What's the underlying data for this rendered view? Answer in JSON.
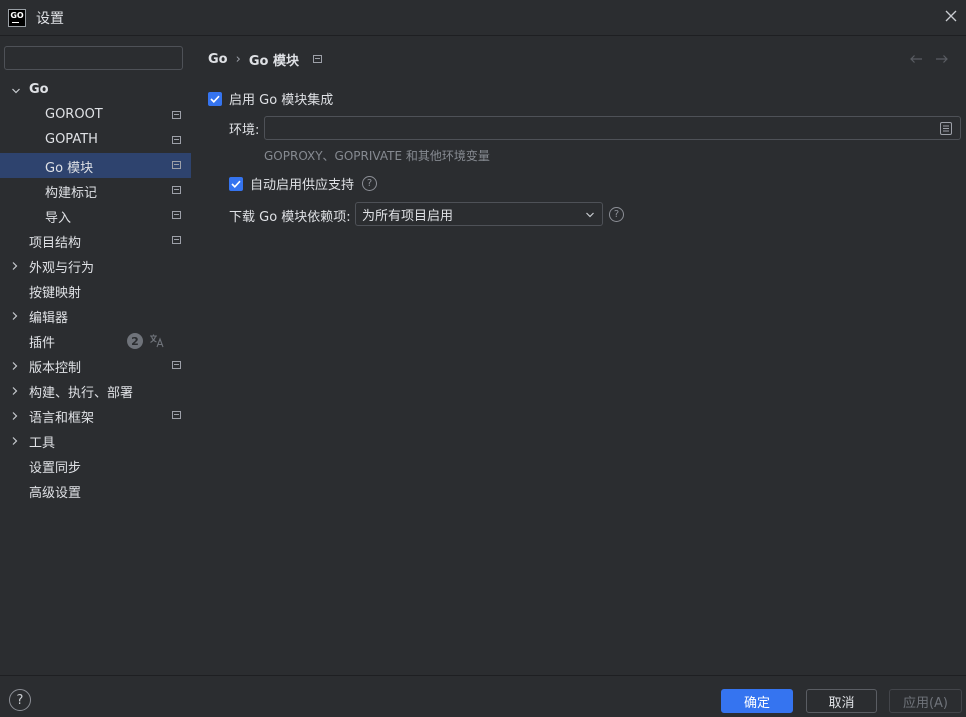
{
  "window": {
    "title": "设置",
    "app_icon_text": "GO"
  },
  "sidebar": {
    "search": {
      "placeholder": "",
      "value": ""
    },
    "items": [
      {
        "label": "Go",
        "level": 0,
        "expanded": true,
        "bold": true,
        "pinned": false
      },
      {
        "label": "GOROOT",
        "level": 1,
        "pinned": true
      },
      {
        "label": "GOPATH",
        "level": 1,
        "pinned": true
      },
      {
        "label": "Go 模块",
        "level": 1,
        "pinned": true,
        "selected": true
      },
      {
        "label": "构建标记",
        "level": 1,
        "pinned": true
      },
      {
        "label": "导入",
        "level": 1,
        "pinned": true
      },
      {
        "label": "项目结构",
        "level": 0,
        "pinned": true
      },
      {
        "label": "外观与行为",
        "level": 0,
        "collapsed": true
      },
      {
        "label": "按键映射",
        "level": 0
      },
      {
        "label": "编辑器",
        "level": 0,
        "collapsed": true
      },
      {
        "label": "插件",
        "level": 0,
        "badge": "2"
      },
      {
        "label": "版本控制",
        "level": 0,
        "collapsed": true,
        "pinned": true
      },
      {
        "label": "构建、执行、部署",
        "level": 0,
        "collapsed": true
      },
      {
        "label": "语言和框架",
        "level": 0,
        "collapsed": true,
        "pinned": true
      },
      {
        "label": "工具",
        "level": 0,
        "collapsed": true
      },
      {
        "label": "设置同步",
        "level": 0
      },
      {
        "label": "高级设置",
        "level": 0
      }
    ]
  },
  "main": {
    "breadcrumb": {
      "parent": "Go",
      "separator": "›",
      "current": "Go 模块"
    },
    "enable_integration": {
      "label": "启用 Go 模块集成",
      "checked": true
    },
    "environment": {
      "label": "环境:",
      "value": "",
      "hint": "GOPROXY、GOPRIVATE 和其他环境变量"
    },
    "vendoring": {
      "label": "自动启用供应支持",
      "checked": true
    },
    "download_deps": {
      "label": "下载 Go 模块依赖项:",
      "selected": "为所有项目启用"
    }
  },
  "footer": {
    "help": "?",
    "ok": "确定",
    "cancel": "取消",
    "apply": "应用(A)"
  },
  "colors": {
    "background": "#2b2d30",
    "selection": "#2e436e",
    "accent": "#3574f0",
    "text": "#dfe1e5",
    "hint": "#868a91"
  }
}
